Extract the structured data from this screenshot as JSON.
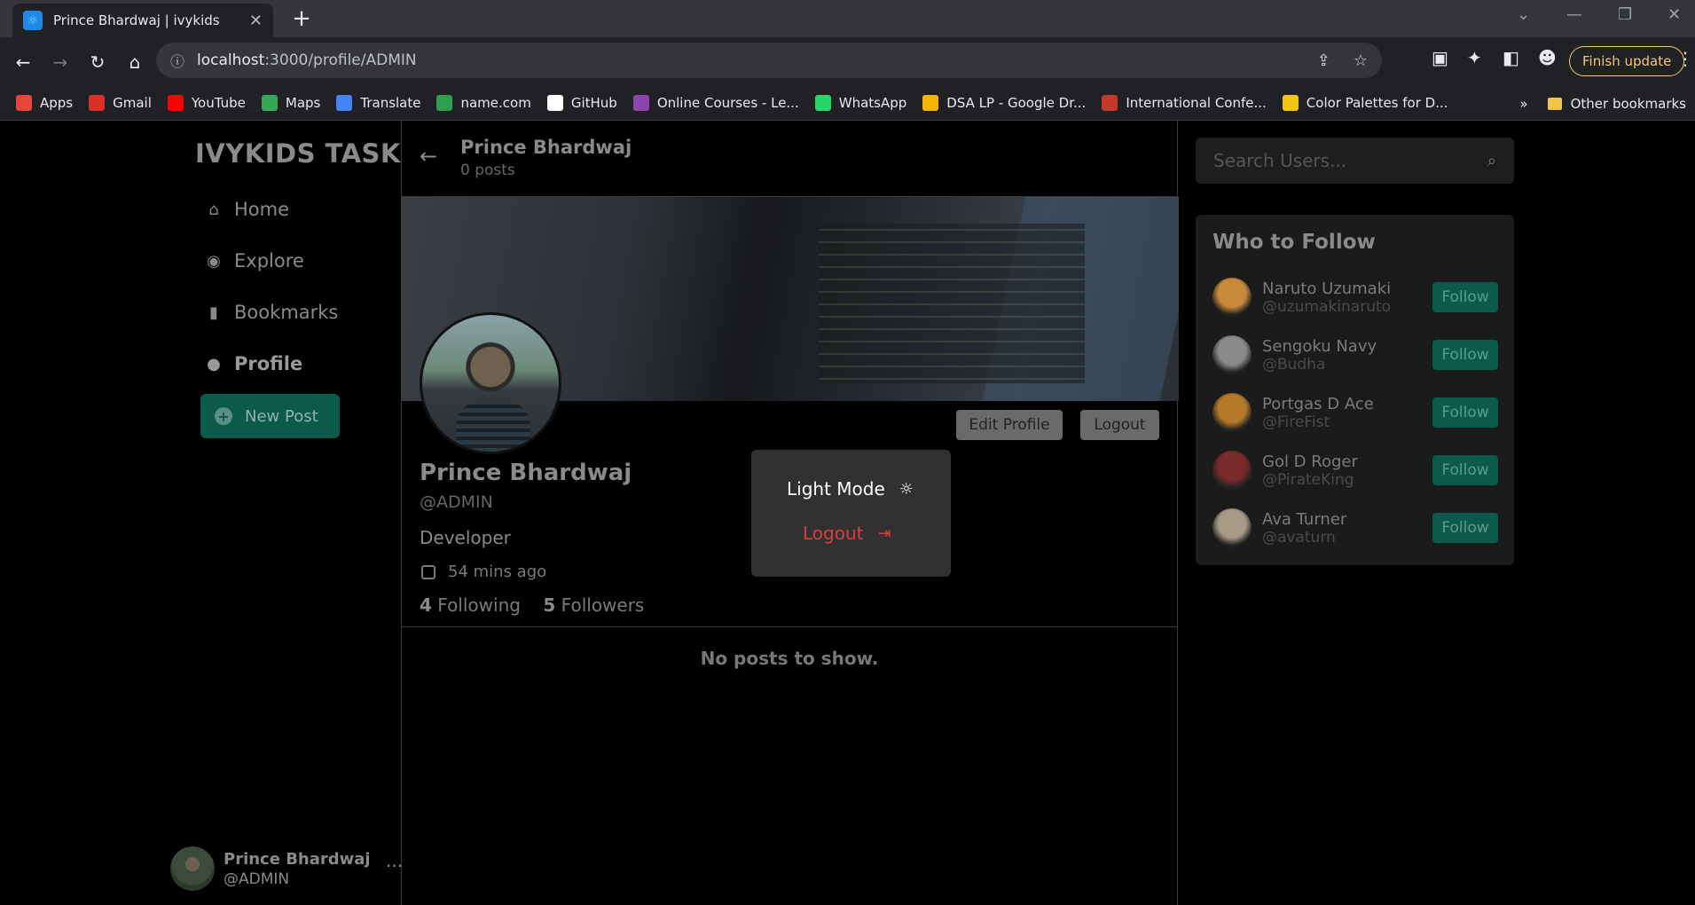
{
  "browser": {
    "tab_title": "Prince Bhardwaj | ivykids",
    "url_host": "localhost",
    "url_path": ":3000/profile/ADMIN",
    "finish_update": "Finish update",
    "bookmarks": [
      {
        "label": "Apps",
        "color": "#e8453c",
        "icon": "apps-grid-icon"
      },
      {
        "label": "Gmail",
        "color": "#d93025",
        "icon": "gmail-icon"
      },
      {
        "label": "YouTube",
        "color": "#ff0000",
        "icon": "youtube-icon"
      },
      {
        "label": "Maps",
        "color": "#34a853",
        "icon": "maps-icon"
      },
      {
        "label": "Translate",
        "color": "#4285f4",
        "icon": "translate-icon"
      },
      {
        "label": "name.com",
        "color": "#2e9e4f",
        "icon": "namecom-icon"
      },
      {
        "label": "GitHub",
        "color": "#ffffff",
        "icon": "github-icon"
      },
      {
        "label": "Online Courses - Le...",
        "color": "#8e44ad",
        "icon": "courses-icon"
      },
      {
        "label": "WhatsApp",
        "color": "#25d366",
        "icon": "whatsapp-icon"
      },
      {
        "label": "DSA LP - Google Dr...",
        "color": "#f4b400",
        "icon": "drive-icon"
      },
      {
        "label": "International Confe...",
        "color": "#c0392b",
        "icon": "conference-icon"
      },
      {
        "label": "Color Palettes for D...",
        "color": "#f1c40f",
        "icon": "palette-icon"
      }
    ],
    "other_bookmarks": "Other bookmarks"
  },
  "sidebar": {
    "logo": "IVYKIDS TASK",
    "nav": [
      {
        "label": "Home",
        "icon": "home-icon"
      },
      {
        "label": "Explore",
        "icon": "compass-icon"
      },
      {
        "label": "Bookmarks",
        "icon": "bookmark-icon"
      },
      {
        "label": "Profile",
        "icon": "user-icon"
      }
    ],
    "new_post": "New Post",
    "me": {
      "name": "Prince Bhardwaj",
      "handle": "@ADMIN"
    }
  },
  "profile": {
    "header_name": "Prince Bhardwaj",
    "post_count": "0 posts",
    "name": "Prince Bhardwaj",
    "handle": "@ADMIN",
    "bio": "Developer",
    "joined": "54 mins ago",
    "following_count": "4",
    "following_label": "Following",
    "followers_count": "5",
    "followers_label": "Followers",
    "edit_profile": "Edit Profile",
    "logout": "Logout",
    "empty": "No posts to show."
  },
  "popup": {
    "light_mode": "Light Mode",
    "logout": "Logout"
  },
  "right": {
    "search_placeholder": "Search Users...",
    "who_to_follow": "Who to Follow",
    "follow_label": "Follow",
    "users": [
      {
        "name": "Naruto Uzumaki",
        "handle": "@uzumakinaruto",
        "color": "#c98a3a"
      },
      {
        "name": "Sengoku Navy",
        "handle": "@Budha",
        "color": "#8a8a8a"
      },
      {
        "name": "Portgas D Ace",
        "handle": "@FireFist",
        "color": "#b5792a"
      },
      {
        "name": "Gol D Roger",
        "handle": "@PirateKing",
        "color": "#7a2a2a"
      },
      {
        "name": "Ava Turner",
        "handle": "@avaturn",
        "color": "#a89a86"
      }
    ]
  },
  "colors": {
    "accent": "#0b5a4c",
    "danger": "#e03b3b"
  }
}
